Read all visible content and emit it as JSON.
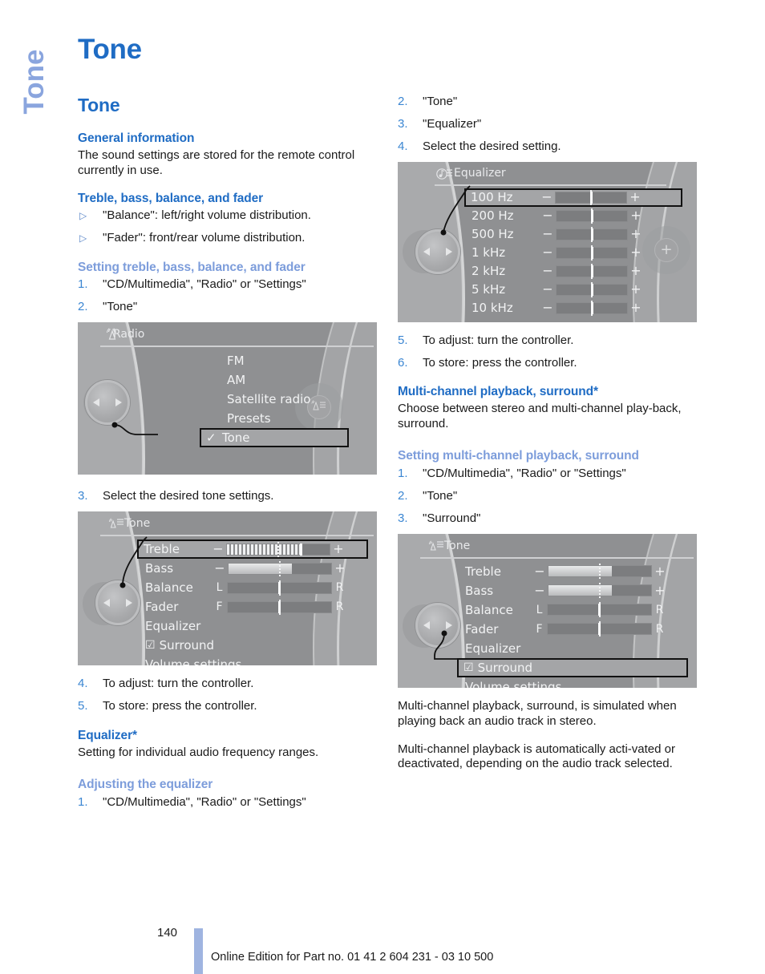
{
  "side_tab": {
    "label": "Tone"
  },
  "page_title": "Tone",
  "left_column": {
    "section_title": "Tone",
    "general": {
      "heading": "General information",
      "body": "The sound settings are stored for the remote control currently in use."
    },
    "treble_bass": {
      "heading": "Treble, bass, balance, and fader",
      "bullets": [
        "\"Balance\": left/right volume distribution.",
        "\"Fader\": front/rear volume distribution."
      ]
    },
    "setting_tbbf": {
      "heading": "Setting treble, bass, balance, and fader",
      "steps": [
        {
          "num": "1.",
          "text": "\"CD/Multimedia\", \"Radio\" or \"Settings\""
        },
        {
          "num": "2.",
          "text": "\"Tone\""
        }
      ]
    },
    "step3": {
      "num": "3.",
      "text": "Select the desired tone settings."
    },
    "steps_after_tone": [
      {
        "num": "4.",
        "text": "To adjust: turn the controller."
      },
      {
        "num": "5.",
        "text": "To store: press the controller."
      }
    ],
    "equalizer": {
      "heading": "Equalizer*",
      "body": "Setting for individual audio frequency ranges."
    },
    "adjusting": {
      "heading": "Adjusting the equalizer",
      "steps": [
        {
          "num": "1.",
          "text": "\"CD/Multimedia\", \"Radio\" or \"Settings\""
        }
      ]
    }
  },
  "right_column": {
    "steps_top": [
      {
        "num": "2.",
        "text": "\"Tone\""
      },
      {
        "num": "3.",
        "text": "\"Equalizer\""
      },
      {
        "num": "4.",
        "text": "Select the desired setting."
      }
    ],
    "steps_after_eq": [
      {
        "num": "5.",
        "text": "To adjust: turn the controller."
      },
      {
        "num": "6.",
        "text": "To store: press the controller."
      }
    ],
    "multichannel": {
      "heading": "Multi-channel playback, surround*",
      "body": "Choose between stereo and multi-channel play-back, surround."
    },
    "setting_multichannel": {
      "heading": "Setting multi-channel playback, surround",
      "steps": [
        {
          "num": "1.",
          "text": "\"CD/Multimedia\", \"Radio\" or \"Settings\""
        },
        {
          "num": "2.",
          "text": "\"Tone\""
        },
        {
          "num": "3.",
          "text": "\"Surround\""
        }
      ]
    },
    "notes": [
      "Multi-channel playback, surround, is simulated when playing back an audio track in stereo.",
      "Multi-channel playback is automatically acti-vated or deactivated, depending on the audio track selected."
    ]
  },
  "screens": {
    "radio": {
      "title": "Radio",
      "icon": "radio-antenna-icon",
      "items": [
        {
          "label": "FM",
          "selected": false,
          "checked": false
        },
        {
          "label": "AM",
          "selected": false,
          "checked": false
        },
        {
          "label": "Satellite radio",
          "selected": false,
          "checked": false
        },
        {
          "label": "Presets",
          "selected": false,
          "checked": false
        },
        {
          "label": "Tone",
          "selected": true,
          "checked": true
        }
      ]
    },
    "tone_treble": {
      "title": "Tone",
      "icon": "tone-speaker-icon",
      "rows": [
        {
          "label": "Treble",
          "type": "pm",
          "selected": true,
          "fill": 72,
          "striped": true
        },
        {
          "label": "Bass",
          "type": "pm",
          "selected": false,
          "fill": 62,
          "striped": false
        },
        {
          "label": "Balance",
          "type": "lr",
          "left": "L",
          "right": "R",
          "marker": 50
        },
        {
          "label": "Fader",
          "type": "lr",
          "left": "F",
          "right": "R",
          "marker": 50
        },
        {
          "label": "Equalizer",
          "type": "plain"
        },
        {
          "label": "Surround",
          "type": "check",
          "checked": true
        },
        {
          "label": "Volume settings",
          "type": "plain"
        }
      ]
    },
    "equalizer": {
      "title": "Equalizer",
      "icon": "equalizer-note-icon",
      "rows": [
        {
          "label": "100 Hz",
          "selected": true,
          "marker": 50
        },
        {
          "label": "200 Hz",
          "selected": false,
          "marker": 50
        },
        {
          "label": "500 Hz",
          "selected": false,
          "marker": 50
        },
        {
          "label": "1 kHz",
          "selected": false,
          "marker": 50
        },
        {
          "label": "2 kHz",
          "selected": false,
          "marker": 50
        },
        {
          "label": "5 kHz",
          "selected": false,
          "marker": 50
        },
        {
          "label": "10 kHz",
          "selected": false,
          "marker": 50
        }
      ],
      "right_button": "+"
    },
    "tone_surround": {
      "title": "Tone",
      "icon": "tone-speaker-icon",
      "rows": [
        {
          "label": "Treble",
          "type": "pm",
          "selected": false,
          "fill": 62,
          "striped": false
        },
        {
          "label": "Bass",
          "type": "pm",
          "selected": false,
          "fill": 62,
          "striped": false
        },
        {
          "label": "Balance",
          "type": "lr",
          "left": "L",
          "right": "R",
          "marker": 50
        },
        {
          "label": "Fader",
          "type": "lr",
          "left": "F",
          "right": "R",
          "marker": 50
        },
        {
          "label": "Equalizer",
          "type": "plain"
        },
        {
          "label": "Surround",
          "type": "check",
          "checked": true,
          "selected": true
        },
        {
          "label": "Volume settings",
          "type": "plain"
        }
      ]
    }
  },
  "footer": {
    "page_number": "140",
    "text": "Online Edition for Part no. 01 41 2 604 231 - 03 10 500"
  },
  "colors": {
    "heading_blue": "#1f6cc4",
    "sub_blue": "#7d9ddb",
    "tab_blue": "#8aa5de",
    "footer_bar": "#9fb4e0"
  }
}
